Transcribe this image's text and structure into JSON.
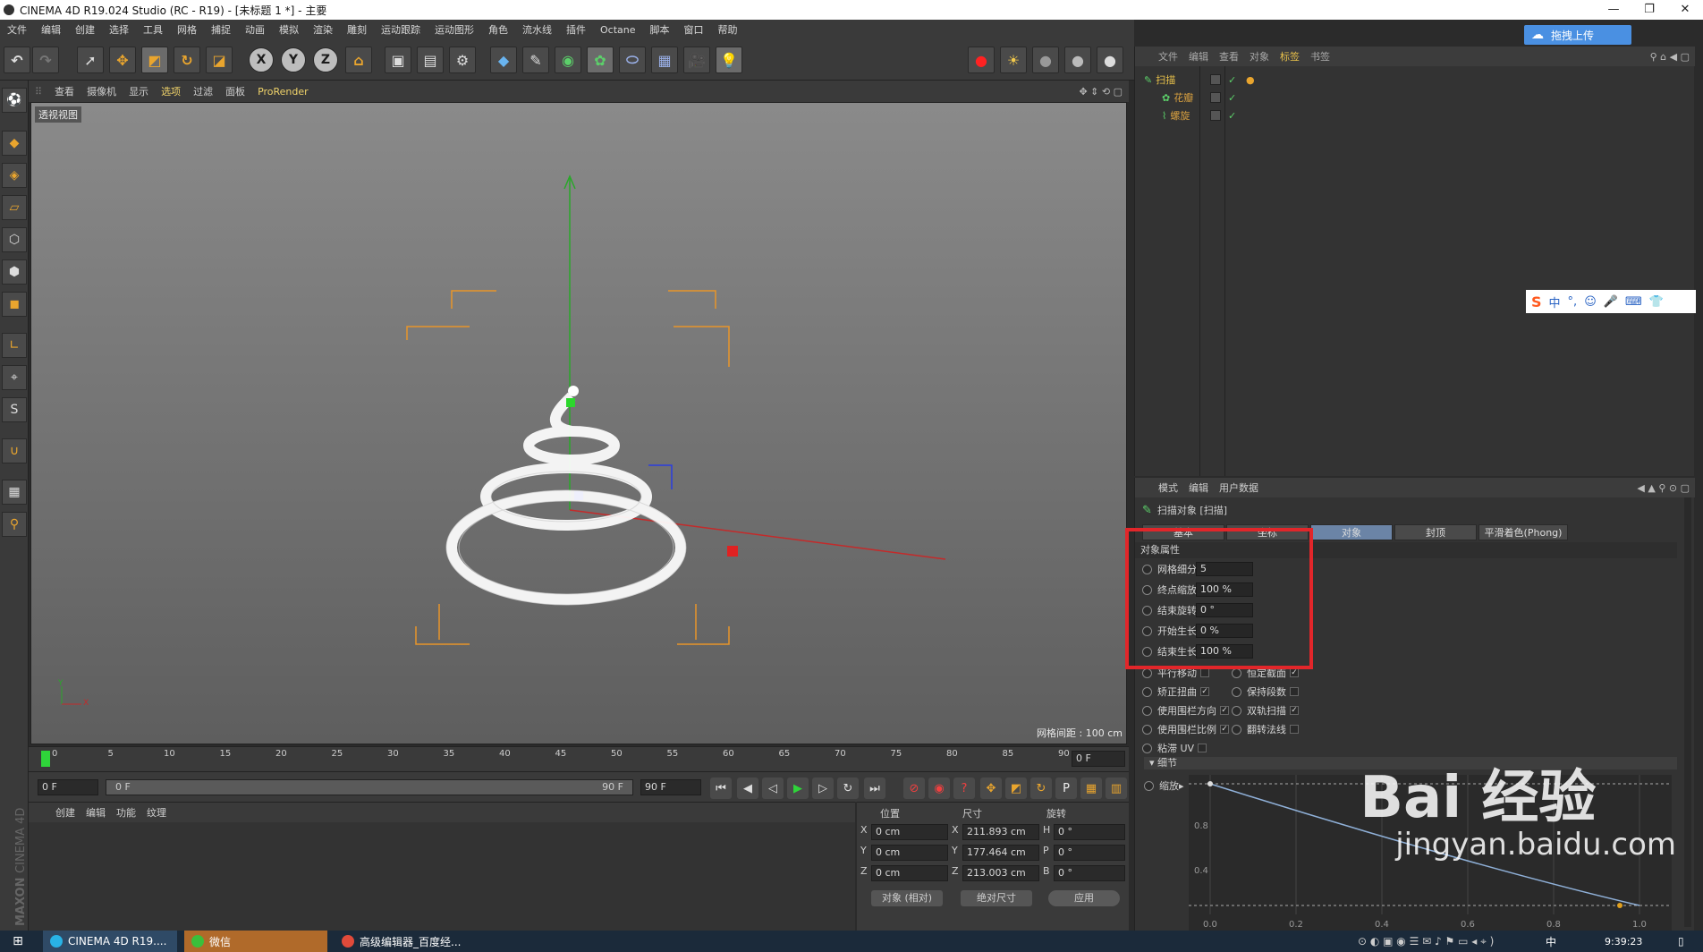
{
  "window": {
    "title": "CINEMA 4D R19.024 Studio (RC - R19) - [未标题 1 *] - 主要",
    "controls": [
      "—",
      "❐",
      "✕"
    ]
  },
  "menu": [
    "文件",
    "编辑",
    "创建",
    "选择",
    "工具",
    "网格",
    "捕捉",
    "动画",
    "模拟",
    "渲染",
    "雕刻",
    "运动跟踪",
    "运动图形",
    "角色",
    "流水线",
    "插件",
    "Octane",
    "脚本",
    "窗口",
    "帮助"
  ],
  "viewport": {
    "menu": [
      "查看",
      "摄像机",
      "显示",
      "选项",
      "过滤",
      "面板",
      "ProRender"
    ],
    "label": "透视视图",
    "grid_label": "网格间距 : 100 cm",
    "axis_y": "Y",
    "axis_x": "X"
  },
  "timeline": {
    "ticks": [
      "0",
      "5",
      "10",
      "15",
      "20",
      "25",
      "30",
      "35",
      "40",
      "45",
      "50",
      "55",
      "60",
      "65",
      "70",
      "75",
      "80",
      "85",
      "90"
    ],
    "current_frame": "0 F",
    "start_field": "0 F",
    "range_start": "0 F",
    "range_end": "90 F",
    "end_field": "90 F"
  },
  "material": {
    "menu": [
      "创建",
      "编辑",
      "功能",
      "纹理"
    ],
    "brand1": "MAXON",
    "brand2": "CINEMA 4D"
  },
  "coord": {
    "headers": [
      "位置",
      "尺寸",
      "旋转"
    ],
    "rows": [
      {
        "axis": "X",
        "pos": "0 cm",
        "size_axis": "X",
        "size": "211.893 cm",
        "rot_axis": "H",
        "rot": "0 °"
      },
      {
        "axis": "Y",
        "pos": "0 cm",
        "size_axis": "Y",
        "size": "177.464 cm",
        "rot_axis": "P",
        "rot": "0 °"
      },
      {
        "axis": "Z",
        "pos": "0 cm",
        "size_axis": "Z",
        "size": "213.003 cm",
        "rot_axis": "B",
        "rot": "0 °"
      }
    ],
    "mode_left": "对象 (相对)",
    "mode_right": "绝对尺寸",
    "apply": "应用"
  },
  "object_manager": {
    "menu": [
      "文件",
      "编辑",
      "查看",
      "对象",
      "标签",
      "书签"
    ],
    "active_menu": "标签",
    "objects": [
      {
        "name": "扫描",
        "color": "#e7c04a"
      },
      {
        "name": "花瓣",
        "color": "#d8a040"
      },
      {
        "name": "螺旋",
        "color": "#d8a040"
      }
    ]
  },
  "attribute_manager": {
    "menu": [
      "模式",
      "编辑",
      "用户数据"
    ],
    "object_title": "扫描对象 [扫描]",
    "tabs": [
      "基本",
      "坐标",
      "对象",
      "封顶",
      "平滑着色(Phong)"
    ],
    "active_tab": "对象",
    "section": "对象属性",
    "params": [
      {
        "label": "网格细分",
        "value": "5"
      },
      {
        "label": "终点缩放",
        "value": "100 %"
      },
      {
        "label": "结束旋转",
        "value": "0 °"
      },
      {
        "label": "开始生长",
        "value": "0 %"
      },
      {
        "label": "结束生长",
        "value": "100 %"
      }
    ],
    "checks_left": [
      {
        "label": "平行移动",
        "checked": false
      },
      {
        "label": "矫正扭曲",
        "checked": true
      },
      {
        "label": "使用围栏方向",
        "checked": true
      },
      {
        "label": "使用围栏比例",
        "checked": true
      },
      {
        "label": "粘滞 UV",
        "checked": false
      }
    ],
    "checks_right": [
      {
        "label": "恒定截面",
        "checked": true
      },
      {
        "label": "保持段数",
        "checked": false
      },
      {
        "label": "双轨扫描",
        "checked": true
      },
      {
        "label": "翻转法线",
        "checked": false
      }
    ],
    "details_label": "细节",
    "scale_label": "缩放",
    "graph_y": [
      "0.8",
      "0.4"
    ],
    "graph_x": [
      "0.0",
      "0.2",
      "0.4",
      "0.6",
      "0.8",
      "1.0"
    ]
  },
  "overlay": {
    "upload": "拖拽上传",
    "watermark_main": "Bai 经验",
    "watermark_sub": "jingyan.baidu.com",
    "ime": "中"
  },
  "taskbar": {
    "items": [
      "CINEMA 4D R19....",
      "微信",
      "高级编辑器_百度经..."
    ],
    "clock": "9:39:23",
    "lang": "中"
  }
}
